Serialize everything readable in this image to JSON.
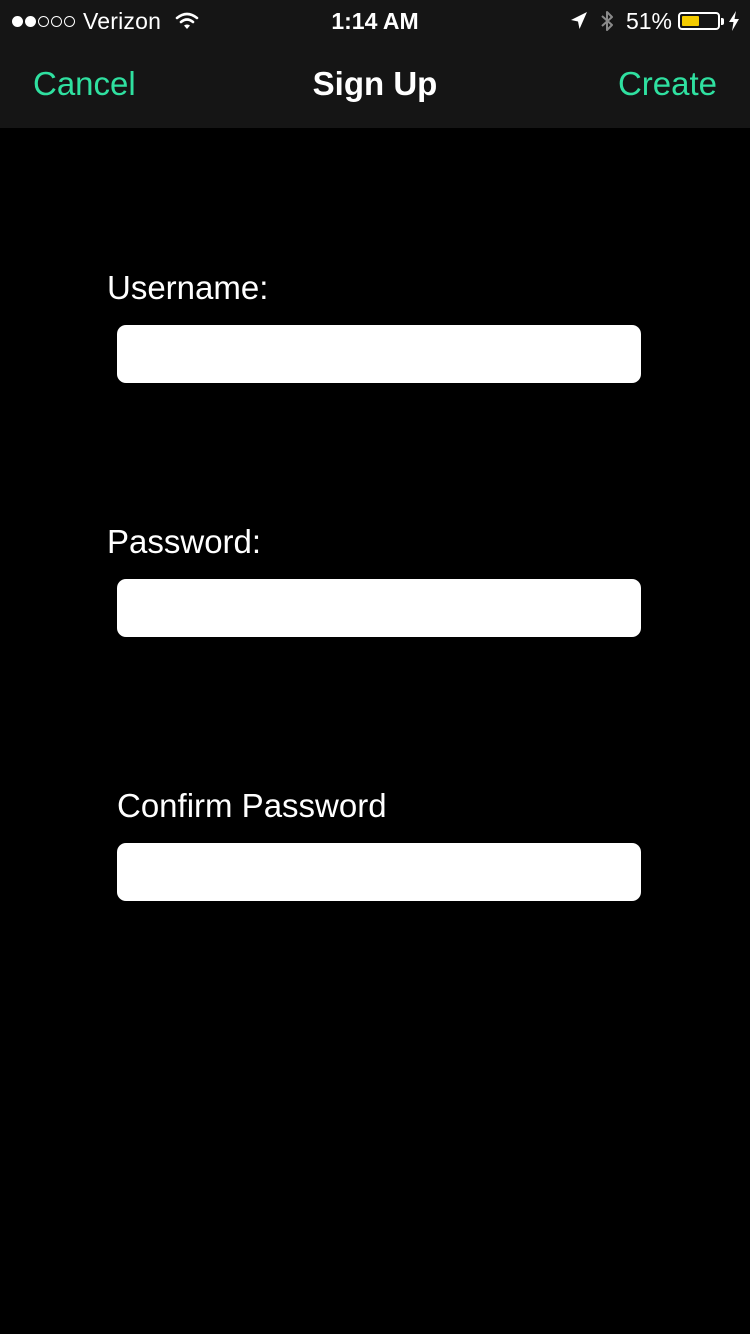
{
  "status_bar": {
    "carrier": "Verizon",
    "signal_bars_filled": 2,
    "signal_bars_total": 5,
    "time": "1:14 AM",
    "battery_percent": "51%",
    "battery_level": 0.51,
    "battery_color": "#f5cc00",
    "icons": [
      "wifi-icon",
      "location-arrow-icon",
      "bluetooth-icon",
      "battery-icon",
      "charging-bolt-icon"
    ]
  },
  "nav": {
    "cancel_label": "Cancel",
    "title": "Sign Up",
    "create_label": "Create",
    "accent_color": "#2fe0a0"
  },
  "form": {
    "username": {
      "label": "Username:",
      "value": "",
      "placeholder": ""
    },
    "password": {
      "label": "Password:",
      "value": "",
      "placeholder": ""
    },
    "confirm_password": {
      "label": "Confirm Password",
      "value": "",
      "placeholder": ""
    }
  }
}
